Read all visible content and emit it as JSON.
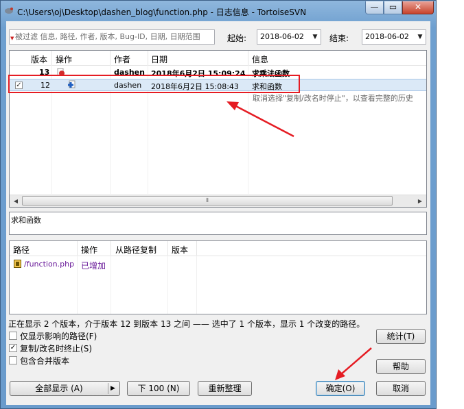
{
  "window": {
    "title": "C:\\Users\\oj\\Desktop\\dashen_blog\\function.php - 日志信息 - TortoiseSVN",
    "controls": {
      "min": "—",
      "max": "▭",
      "close": "✕"
    }
  },
  "filter": {
    "placeholder": "被过滤 信息, 路径, 作者, 版本, Bug-ID, 日期, 日期范围",
    "from_label": "起始:",
    "from_value": "2018-06-02",
    "to_label": "结束:",
    "to_value": "2018-06-02"
  },
  "log_table": {
    "columns": [
      "版本",
      "操作",
      "作者",
      "日期",
      "信息"
    ],
    "rows": [
      {
        "revision": "13",
        "author": "dashen",
        "date": "2018年6月2日 15:09:24",
        "message": "求乘法函数",
        "bold": true,
        "checked": false
      },
      {
        "revision": "12",
        "author": "dashen",
        "date": "2018年6月2日 15:08:43",
        "message": "求和函数",
        "bold": false,
        "checked": true
      }
    ],
    "hint": "取消选择\"复制/改名时停止\"，以查看完整的历史"
  },
  "message_text": "求和函数",
  "paths_table": {
    "columns": [
      "路径",
      "操作",
      "从路径复制",
      "版本"
    ],
    "rows": [
      {
        "path": "/function.php",
        "action": "已增加",
        "copyfrom": "",
        "rev": ""
      }
    ]
  },
  "status_text": "正在显示 2 个版本，介于版本 12 到版本 13 之间 —— 选中了 1 个版本，显示 1 个改变的路径。",
  "options": {
    "only_affected": "仅显示影响的路径(F)",
    "stop_on_copy": "复制/改名时终止(S)",
    "include_merged": "包含合并版本"
  },
  "buttons": {
    "stats": "统计(T)",
    "help": "帮助",
    "show_all": "全部显示 (A)",
    "next100": "下 100 (N)",
    "refresh": "重新整理",
    "ok": "确定(O)",
    "cancel": "取消"
  },
  "colors": {
    "highlight": "#e51c23",
    "selection": "#dbe9f7"
  }
}
